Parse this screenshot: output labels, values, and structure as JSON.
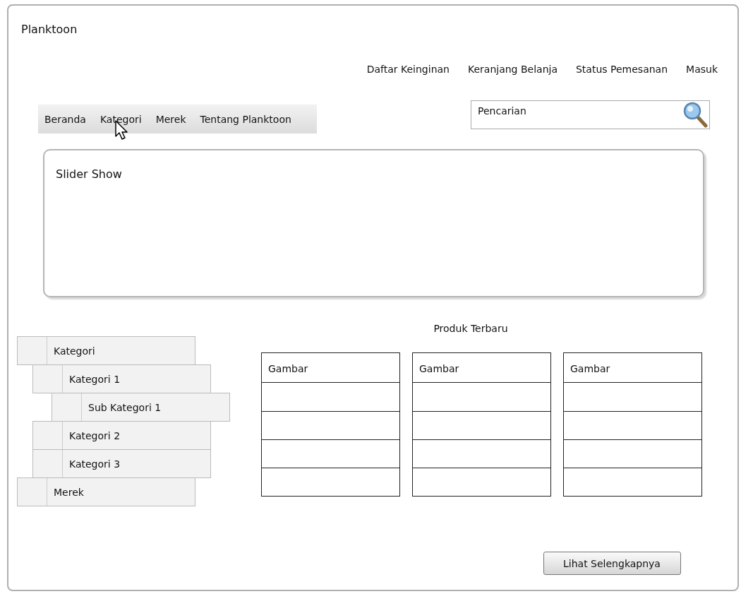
{
  "site_title": "Planktoon",
  "top_links": [
    "Daftar Keinginan",
    "Keranjang Belanja",
    "Status Pemesanan",
    "Masuk"
  ],
  "nav_items": [
    {
      "label": "Beranda",
      "hovered": false
    },
    {
      "label": "Kategori",
      "hovered": true
    },
    {
      "label": "Merek",
      "hovered": false
    },
    {
      "label": "Tentang Planktoon",
      "hovered": false
    }
  ],
  "search": {
    "placeholder": "Pencarian"
  },
  "slider": {
    "label": "Slider Show"
  },
  "category_tree": [
    {
      "label": "Kategori",
      "children": [
        {
          "label": "Kategori 1",
          "children": [
            {
              "label": "Sub Kategori 1"
            }
          ]
        },
        {
          "label": "Kategori 2"
        },
        {
          "label": "Kategori 3"
        }
      ]
    },
    {
      "label": "Merek"
    }
  ],
  "products": {
    "title": "Produk Terbaru",
    "cards": [
      {
        "label": "Gambar"
      },
      {
        "label": "Gambar"
      },
      {
        "label": "Gambar"
      }
    ]
  },
  "more_button": "Lihat Selengkapnya"
}
